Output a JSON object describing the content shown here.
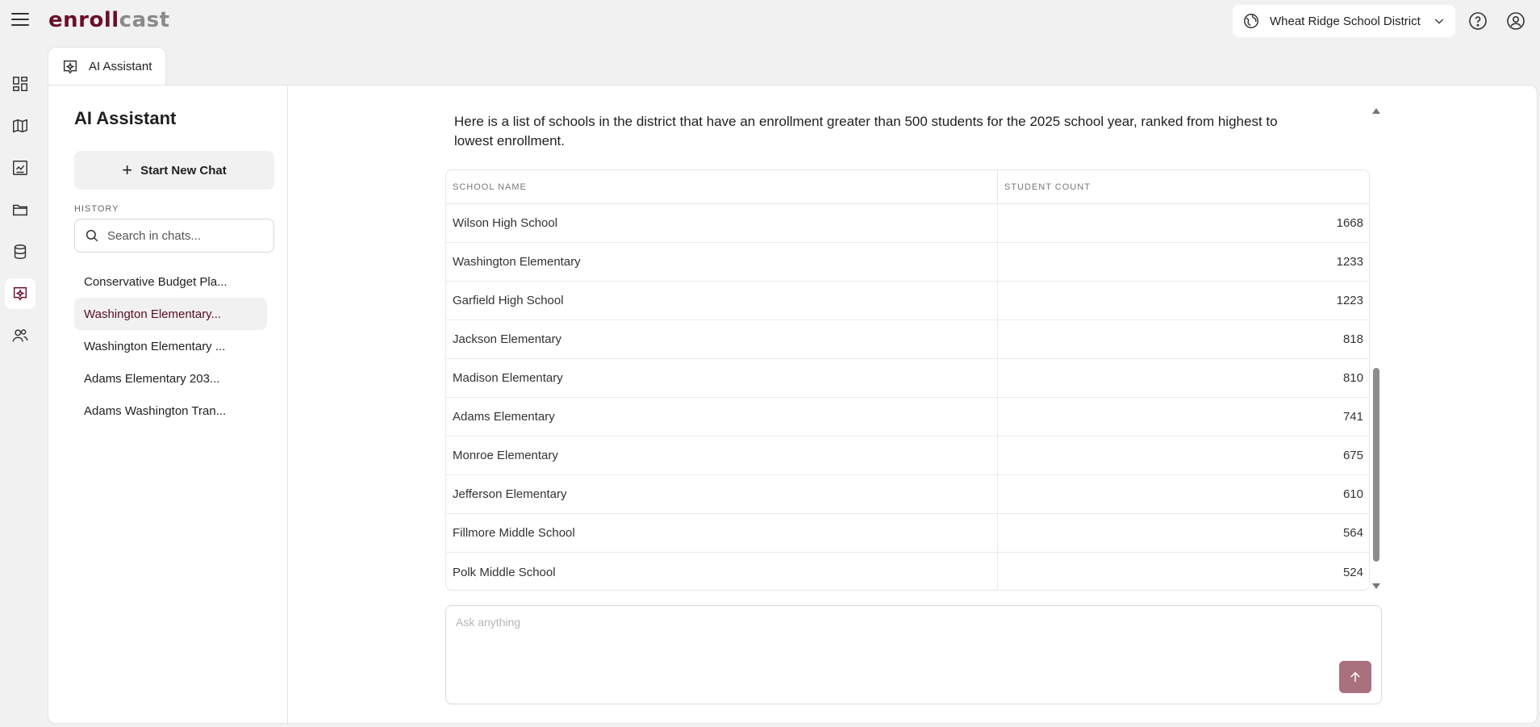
{
  "app": {
    "logo_part1": "enroll",
    "logo_part2": "cast"
  },
  "header": {
    "district": "Wheat Ridge School District"
  },
  "tab": {
    "label": "AI Assistant"
  },
  "sidebar": {
    "title": "AI Assistant",
    "new_chat_label": "Start New Chat",
    "history_label": "HISTORY",
    "search_placeholder": "Search in chats...",
    "history": [
      "Conservative Budget Pla...",
      "Washington Elementary...",
      "Washington Elementary ...",
      "Adams Elementary 203...",
      "Adams Washington Tran..."
    ]
  },
  "chat": {
    "intro": "Here is a list of schools in the district that have an enrollment greater than 500 students for the 2025 school year, ranked from highest to lowest enrollment.",
    "table": {
      "headers": [
        "SCHOOL NAME",
        "STUDENT COUNT"
      ],
      "rows": [
        [
          "Wilson High School",
          "1668"
        ],
        [
          "Washington Elementary",
          "1233"
        ],
        [
          "Garfield High School",
          "1223"
        ],
        [
          "Jackson Elementary",
          "818"
        ],
        [
          "Madison Elementary",
          "810"
        ],
        [
          "Adams Elementary",
          "741"
        ],
        [
          "Monroe Elementary",
          "675"
        ],
        [
          "Jefferson Elementary",
          "610"
        ],
        [
          "Fillmore Middle School",
          "564"
        ],
        [
          "Polk Middle School",
          "524"
        ]
      ]
    }
  },
  "composer": {
    "placeholder": "Ask anything"
  },
  "colors": {
    "brand": "#6b0f2a",
    "send_button": "#a9707d",
    "active_history_text": "#5a0d22"
  },
  "icons": {
    "rail": [
      "dashboard-icon",
      "map-icon",
      "report-icon",
      "folder-icon",
      "database-icon",
      "ai-assistant-icon",
      "users-icon"
    ]
  }
}
